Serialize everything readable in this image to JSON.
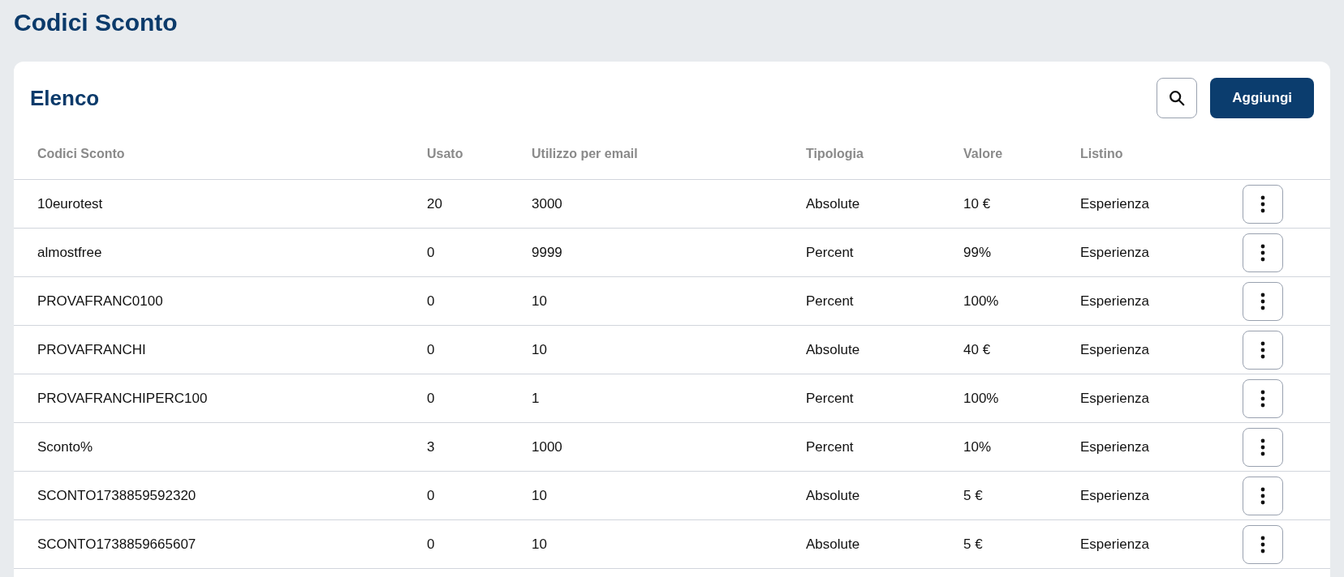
{
  "page_title": "Codici Sconto",
  "card": {
    "title": "Elenco",
    "add_button": "Aggiungi"
  },
  "table": {
    "columns": [
      "Codici Sconto",
      "Usato",
      "Utilizzo per email",
      "Tipologia",
      "Valore",
      "Listino"
    ],
    "rows": [
      {
        "code": "10eurotest",
        "used": "20",
        "per_email": "3000",
        "type": "Absolute",
        "value": "10 €",
        "list": "Esperienza"
      },
      {
        "code": "almostfree",
        "used": "0",
        "per_email": "9999",
        "type": "Percent",
        "value": "99%",
        "list": "Esperienza"
      },
      {
        "code": "PROVAFRANC0100",
        "used": "0",
        "per_email": "10",
        "type": "Percent",
        "value": "100%",
        "list": "Esperienza"
      },
      {
        "code": "PROVAFRANCHI",
        "used": "0",
        "per_email": "10",
        "type": "Absolute",
        "value": "40 €",
        "list": "Esperienza"
      },
      {
        "code": "PROVAFRANCHIPERC100",
        "used": "0",
        "per_email": "1",
        "type": "Percent",
        "value": "100%",
        "list": "Esperienza"
      },
      {
        "code": "Sconto%",
        "used": "3",
        "per_email": "1000",
        "type": "Percent",
        "value": "10%",
        "list": "Esperienza"
      },
      {
        "code": "SCONTO1738859592320",
        "used": "0",
        "per_email": "10",
        "type": "Absolute",
        "value": "5 €",
        "list": "Esperienza"
      },
      {
        "code": "SCONTO1738859665607",
        "used": "0",
        "per_email": "10",
        "type": "Absolute",
        "value": "5 €",
        "list": "Esperienza"
      }
    ]
  }
}
